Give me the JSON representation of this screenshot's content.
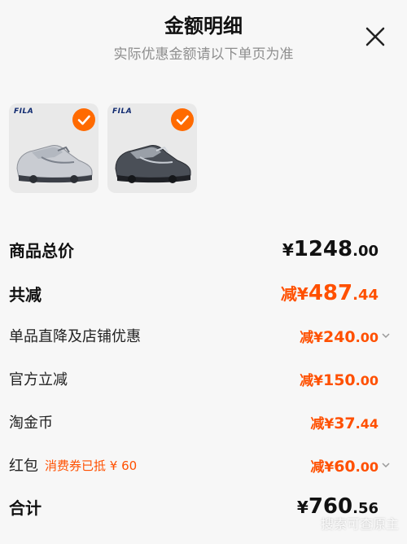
{
  "header": {
    "title": "金额明细",
    "subtitle": "实际优惠金额请以下单页为准",
    "close_icon": "close-icon"
  },
  "products": [
    {
      "brand": "FILA",
      "color": "light-grey",
      "selected": true
    },
    {
      "brand": "FILA",
      "color": "dark-grey",
      "selected": true
    }
  ],
  "rows": {
    "total_price": {
      "label": "商品总价",
      "prefix": "¥",
      "int": "1248",
      "dec": ".00"
    },
    "total_discount": {
      "label": "共减",
      "prefix": "减¥",
      "int": "487",
      "dec": ".44"
    },
    "item_discount": {
      "label": "单品直降及店铺优惠",
      "prefix": "减¥",
      "int": "240",
      "dec": ".00"
    },
    "official_discount": {
      "label": "官方立减",
      "prefix": "减¥",
      "int": "150",
      "dec": ".00"
    },
    "taojinbi": {
      "label": "淘金币",
      "prefix": "减¥",
      "int": "37",
      "dec": ".44"
    },
    "red_packet": {
      "label": "红包",
      "note": "消费券已抵 ¥ 60",
      "prefix": "减¥",
      "int": "60",
      "dec": ".00"
    },
    "grand_total": {
      "label": "合计",
      "prefix": "¥",
      "int": "760",
      "dec": ".56"
    }
  },
  "watermark": "搜索可查原主",
  "colors": {
    "accent": "#ff5000",
    "badge": "#ff6a00",
    "background": "#f7f7f7"
  }
}
